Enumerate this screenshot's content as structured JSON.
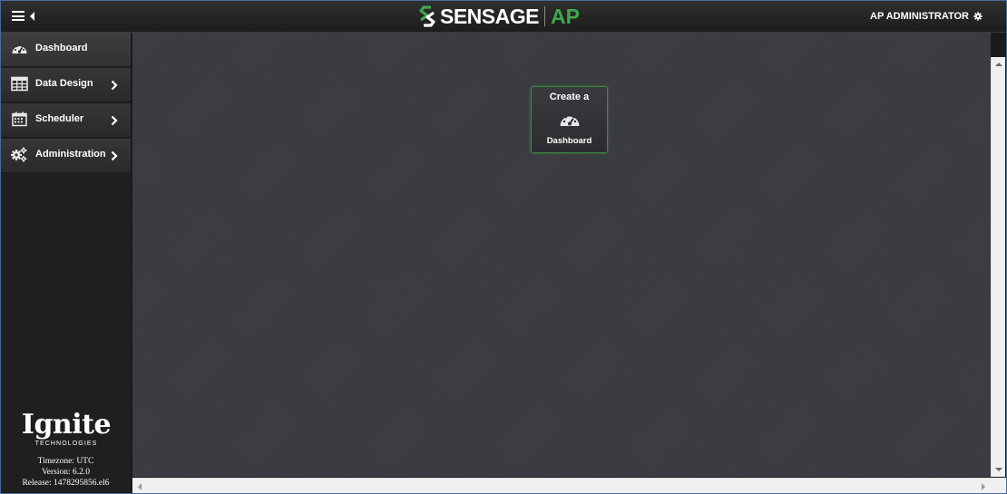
{
  "header": {
    "menu_icon": "hamburger-icon",
    "logo_text": "SENSAGE",
    "logo_suffix": "AP",
    "user_name": "AP ADMINISTRATOR",
    "user_icon": "gear-icon"
  },
  "sidebar": {
    "items": [
      {
        "label": "Dashboard",
        "icon": "dashboard-icon",
        "has_submenu": false
      },
      {
        "label": "Data Design",
        "icon": "table-icon",
        "has_submenu": true
      },
      {
        "label": "Scheduler",
        "icon": "calendar-icon",
        "has_submenu": true
      },
      {
        "label": "Administration",
        "icon": "gears-icon",
        "has_submenu": true
      }
    ],
    "brand": {
      "name": "Ignite",
      "tagline": "TECHNOLOGIES"
    },
    "timezone": "Timezone: UTC",
    "version": "Version: 6.2.0",
    "release": "Release: 1478295856.el6"
  },
  "main": {
    "create_card": {
      "top_label": "Create a",
      "icon": "dashboard-icon",
      "bottom_label": "Dashboard"
    }
  },
  "colors": {
    "accent": "#3daa4a",
    "topbar": "#262626",
    "sidebar": "#2e2e2e",
    "content_bg": "#3b3c42"
  }
}
